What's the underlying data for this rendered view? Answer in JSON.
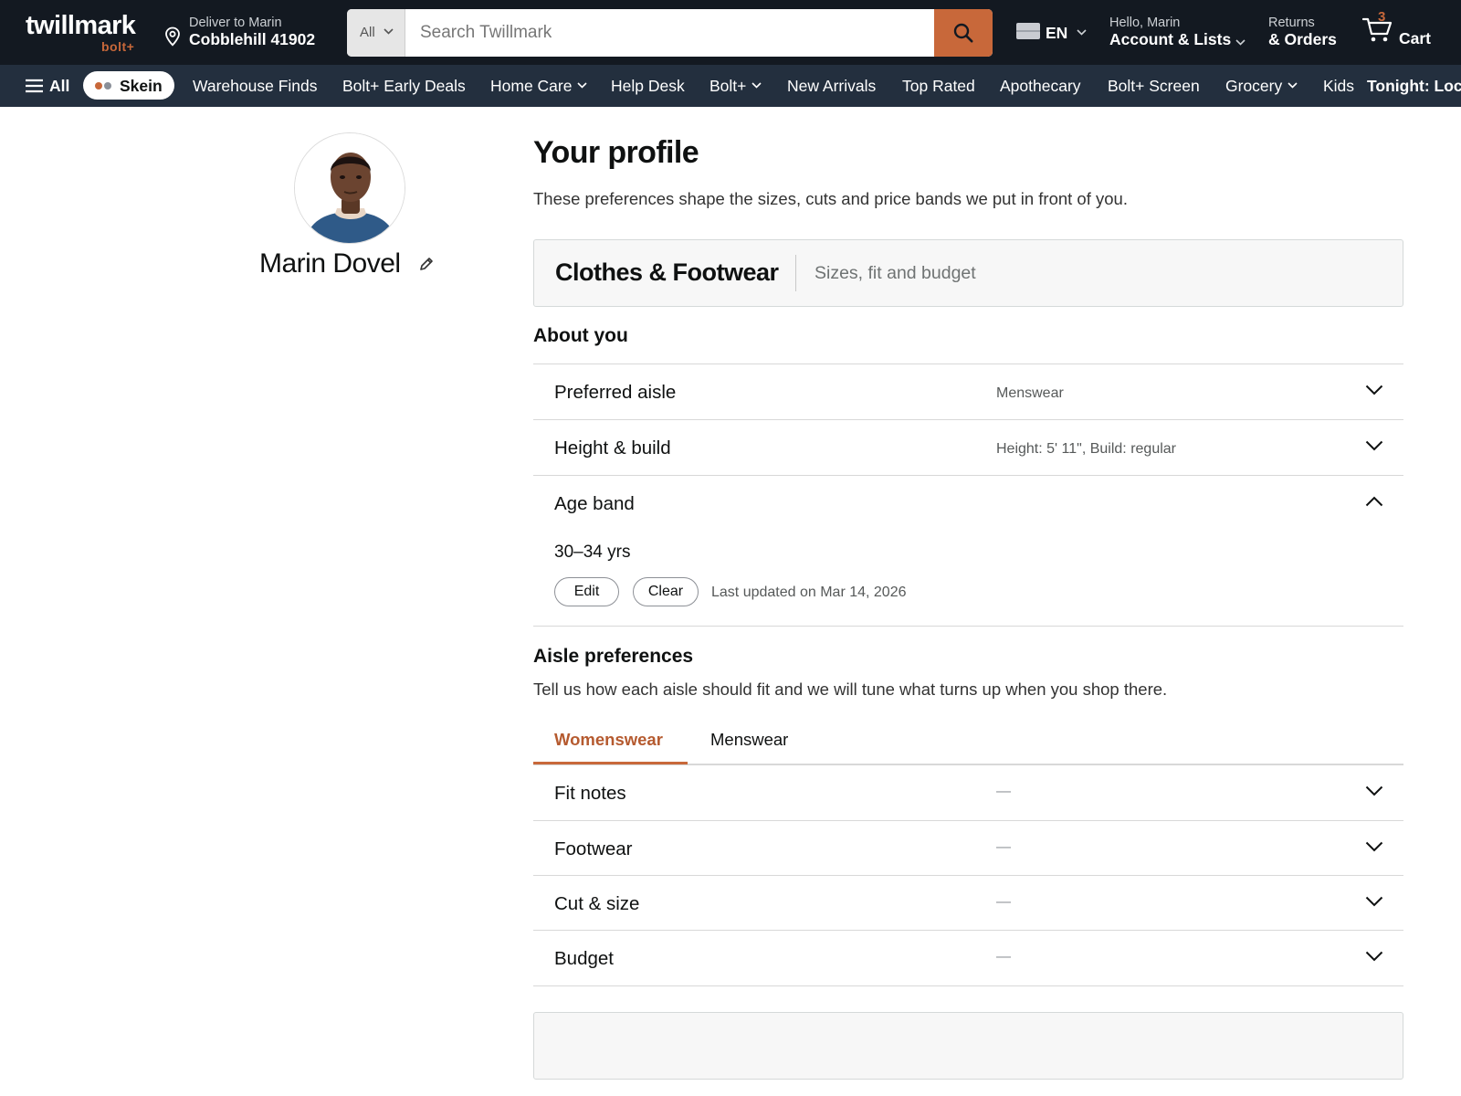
{
  "header": {
    "logo": "twillmark",
    "logo_sub": "bolt+",
    "deliver_line1": "Deliver to Marin",
    "deliver_line2": "Cobblehill 41902",
    "search_category": "All",
    "search_placeholder": "Search Twillmark",
    "language": "EN",
    "account_line1": "Hello, Marin",
    "account_line2": "Account & Lists",
    "orders_line1": "Returns",
    "orders_line2": "& Orders",
    "cart_count": "3",
    "cart_label": "Cart"
  },
  "nav": {
    "all_label": "All",
    "skein_label": "Skein",
    "items": [
      "Warehouse Finds",
      "Bolt+ Early Deals",
      "Home Care",
      "Help Desk",
      "Bolt+",
      "New Arrivals",
      "Top Rated",
      "Apothecary",
      "Bolt+ Screen",
      "Grocery",
      "Kids"
    ],
    "promo": "Tonight: Loc"
  },
  "profile": {
    "name": "Marin Dovel"
  },
  "page": {
    "title": "Your profile",
    "subtitle": "These preferences shape the sizes, cuts and price bands we put in front of you.",
    "category_title": "Clothes & Footwear",
    "category_subtitle": "Sizes, fit and budget"
  },
  "about": {
    "heading": "About you",
    "rows": [
      {
        "label": "Preferred aisle",
        "value": "Menswear"
      },
      {
        "label": "Height & build",
        "value": "Height: 5' 11\", Build: regular"
      },
      {
        "label": "Age band",
        "value": ""
      }
    ],
    "expanded_value": "30–34 yrs",
    "edit_label": "Edit",
    "clear_label": "Clear",
    "last_updated": "Last updated on Mar 14, 2026"
  },
  "aisle": {
    "heading": "Aisle preferences",
    "description": "Tell us how each aisle should fit and we will tune what turns up when you shop there.",
    "tabs": [
      "Womenswear",
      "Menswear"
    ],
    "active_tab": "Womenswear",
    "rows": [
      {
        "label": "Fit notes",
        "value": "—"
      },
      {
        "label": "Footwear",
        "value": "—"
      },
      {
        "label": "Cut & size",
        "value": "—"
      },
      {
        "label": "Budget",
        "value": "—"
      }
    ]
  },
  "colors": {
    "header_bg": "#131921",
    "nav_bg": "#232f3e",
    "accent": "#c8683a"
  }
}
